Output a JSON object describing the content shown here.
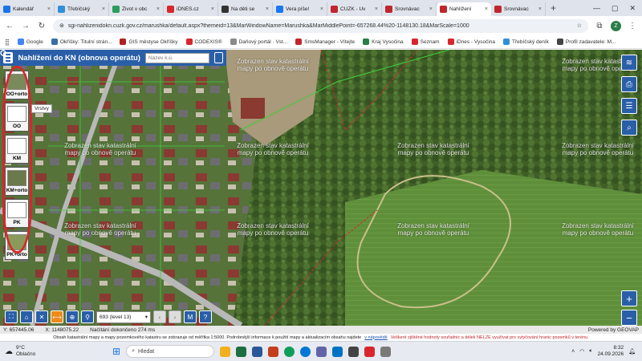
{
  "browser": {
    "tabs": [
      {
        "label": "Kalendář",
        "color": "#1a73e8"
      },
      {
        "label": "Třebíčský",
        "color": "#2f8fd8"
      },
      {
        "label": "Život v obc",
        "color": "#2a9d5a"
      },
      {
        "label": "iDNES.cz",
        "color": "#d8262c"
      },
      {
        "label": "Na děti se",
        "color": "#333333"
      },
      {
        "label": "Vera píše!",
        "color": "#1877f2"
      },
      {
        "label": "ČÚZK - Úv",
        "color": "#c0262c"
      },
      {
        "label": "Srovnávac",
        "color": "#c0262c"
      },
      {
        "label": "Nahlížení",
        "color": "#c0262c",
        "active": true
      },
      {
        "label": "Srovnávac",
        "color": "#c0262c"
      }
    ],
    "url": "sgi-nahlizenidokn.cuzk.gov.cz/marushka/default.aspx?themeid=13&MarWindowName=Marushka&MarMiddlePoint=-657268.44%20-1148130.18&MarScale=1000",
    "profile_initial": "Z",
    "bookmarks": [
      {
        "label": "Google",
        "color": "#4285f4"
      },
      {
        "label": "Okříšky: Titulní strán...",
        "color": "#3b6ea8"
      },
      {
        "label": "GIS městyse Okříšky",
        "color": "#b02020"
      },
      {
        "label": "CODEXIS®",
        "color": "#d8262c"
      },
      {
        "label": "Daňový portál · Vst...",
        "color": "#8a8a8a"
      },
      {
        "label": "SmsManager - Vítejte",
        "color": "#c0262c"
      },
      {
        "label": "Kraj Vysočina",
        "color": "#2a7d46"
      },
      {
        "label": "Seznam",
        "color": "#d8262c"
      },
      {
        "label": "iDnes - Vysočina",
        "color": "#d8262c"
      },
      {
        "label": "Třebíčský deník",
        "color": "#2f8fd8"
      },
      {
        "label": "Profil zadavatele: M...",
        "color": "#444444"
      }
    ]
  },
  "app": {
    "title": "Nahlížení do KN (obnova operátu)",
    "search_placeholder": "Název k.ú.",
    "watermark": "Zobrazen stav katastrální mapy po obnově operátu",
    "layer_buttons": [
      {
        "label": "OO+orto"
      },
      {
        "label": "OO"
      },
      {
        "label": "KM"
      },
      {
        "label": "KM+orto"
      },
      {
        "label": "PK"
      },
      {
        "label": "PK+orto"
      }
    ],
    "tooltip": "Vrstvy",
    "level_select": "693 (level 13)"
  },
  "status": {
    "y_coord": "Y: 657445.06",
    "x_coord": "X: 1148075.22",
    "load_status": "Načítání dokončeno 274 ms",
    "powered": "Powered by GEOVAP",
    "info_text": "Obsah katastrální mapy a mapy pozemkového katastru se zobrazuje od měřítka 1:5000. Podrobnější informace k použití mapy a aktualizacím obsahu najdete",
    "info_link": "v nápovědě",
    "warning": "Veškeré zjištěné hodnoty souřadnic a délek NELZE využívat pro vytyčování hranic pozemků v terénu."
  },
  "taskbar": {
    "temperature": "9°C",
    "weather_text": "Oblačno",
    "search_label": "Hledat",
    "time": "8:32",
    "date": "24.09.2026"
  },
  "colors": {
    "app_blue": "#2a5fa8",
    "highlight_red": "#d8262c"
  }
}
